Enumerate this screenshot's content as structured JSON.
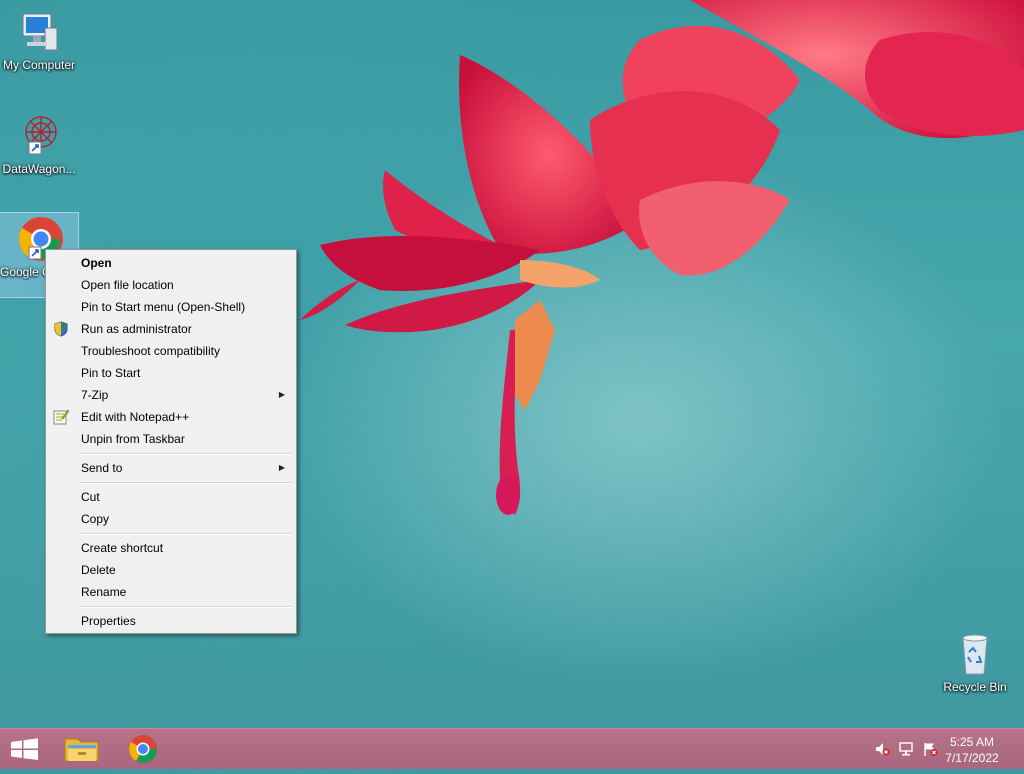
{
  "desktop": {
    "icons": [
      {
        "label": "My Computer"
      },
      {
        "label": "DataWagon..."
      },
      {
        "label": "Google Chrome",
        "label_visible": "Goog Chro"
      },
      {
        "label": "Recycle Bin"
      }
    ]
  },
  "context_menu": {
    "items": [
      {
        "label": "Open",
        "bold": true
      },
      {
        "label": "Open file location"
      },
      {
        "label": "Pin to Start menu (Open-Shell)"
      },
      {
        "label": "Run as administrator",
        "icon": "uac-shield-icon"
      },
      {
        "label": "Troubleshoot compatibility"
      },
      {
        "label": "Pin to Start"
      },
      {
        "label": "7-Zip",
        "submenu": true
      },
      {
        "label": "Edit with Notepad++",
        "icon": "notepadpp-icon"
      },
      {
        "label": "Unpin from Taskbar"
      },
      {
        "label": "Send to",
        "submenu": true
      },
      {
        "label": "Cut"
      },
      {
        "label": "Copy"
      },
      {
        "label": "Create shortcut"
      },
      {
        "label": "Delete"
      },
      {
        "label": "Rename"
      },
      {
        "label": "Properties"
      }
    ]
  },
  "taskbar": {
    "start_icon": "windows-start-icon",
    "pinned": [
      "file-explorer-icon",
      "chrome-icon"
    ],
    "tray": [
      "volume-muted-icon",
      "network-icon",
      "action-center-flag-icon"
    ],
    "clock": {
      "time": "5:25 AM",
      "date": "7/17/2022"
    }
  },
  "colors": {
    "desktop_teal": "#3f9fa7",
    "taskbar": "#ad6b82",
    "menu_bg": "#f0f0f0",
    "selection": "#add8ff"
  }
}
